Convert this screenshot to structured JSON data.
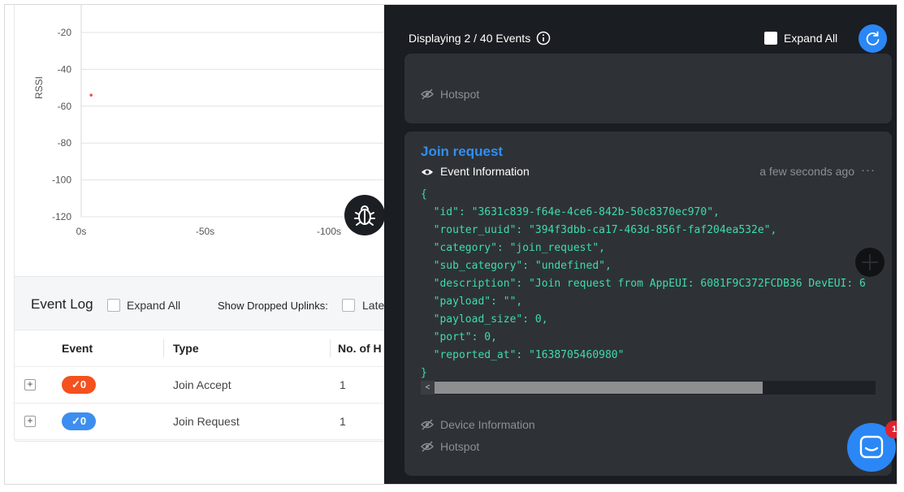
{
  "chart": {
    "y_axis_label": "RSSI",
    "y_ticks": [
      "-20",
      "-40",
      "-60",
      "-80",
      "-100",
      "-120"
    ],
    "x_ticks": [
      "0s",
      "-50s",
      "-100s"
    ]
  },
  "chart_data": {
    "type": "scatter",
    "xlabel": "",
    "ylabel": "RSSI",
    "x_tick_labels": [
      "0s",
      "-50s",
      "-100s"
    ],
    "y_tick_labels": [
      "-20",
      "-40",
      "-60",
      "-80",
      "-100",
      "-120"
    ],
    "ylim": [
      -120,
      -20
    ],
    "points": [
      {
        "x": -4,
        "y": -54
      }
    ],
    "point_color": "#e8524f",
    "grid": true
  },
  "event_log": {
    "title": "Event Log",
    "expand_all_label": "Expand All",
    "show_dropped_label": "Show Dropped Uplinks:",
    "latest_label": "Late",
    "columns": [
      "Event",
      "Type",
      "No. of H"
    ],
    "rows": [
      {
        "expand": "+",
        "badge": "✓0",
        "badge_color": "#f4511e",
        "type": "Join Accept",
        "count": "1"
      },
      {
        "expand": "+",
        "badge": "✓0",
        "badge_color": "#3d8ef0",
        "type": "Join Request",
        "count": "1"
      }
    ]
  },
  "debug_button": {
    "icon": "bug-icon"
  },
  "panel": {
    "header_title": "Displaying 2 / 40 Events",
    "expand_all_label": "Expand All",
    "refresh_icon": "refresh-icon",
    "prev_event": {
      "hotspot_label": "Hotspot"
    },
    "event": {
      "title": "Join request",
      "info_label": "Event Information",
      "time": "a few seconds ago",
      "more": "···",
      "json_lines": [
        "{",
        "  \"id\": \"3631c839-f64e-4ce6-842b-50c8370ec970\",",
        "  \"router_uuid\": \"394f3dbb-ca17-463d-856f-faf204ea532e\",",
        "  \"category\": \"join_request\",",
        "  \"sub_category\": \"undefined\",",
        "  \"description\": \"Join request from AppEUI: 6081F9C372FCDB36 DevEUI: 6",
        "  \"payload\": \"\",",
        "  \"payload_size\": 0,",
        "  \"port\": 0,",
        "  \"reported_at\": \"1638705460980\"",
        "}"
      ],
      "scroll_left": "<",
      "device_info_label": "Device Information",
      "hotspot_label": "Hotspot"
    }
  },
  "chat": {
    "badge_count": "1"
  }
}
